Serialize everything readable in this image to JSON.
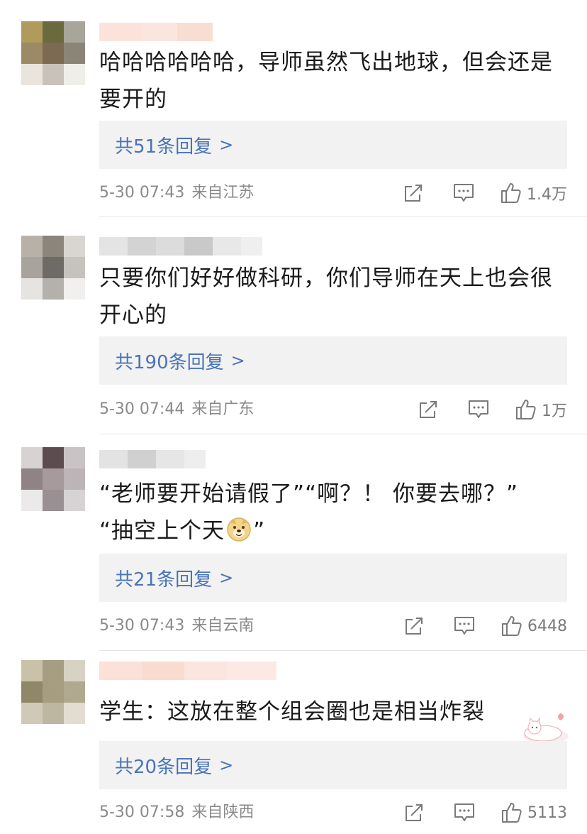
{
  "comments": [
    {
      "text": "哈哈哈哈哈哈，导师虽然飞出地球，但会还是要开的",
      "reply_count_label": "共51条回复",
      "reply_arrow": ">",
      "time": "5-30 07:43",
      "location": "来自江苏",
      "likes": "1.4万",
      "avatar_colors": [
        "#b09a5c",
        "#6b6a3e",
        "#a8a59a",
        "#9c8a66",
        "#7d6a52",
        "#8a8577",
        "#e9e4dc",
        "#c8c2ba",
        "#f0eee9"
      ]
    },
    {
      "text": "只要你们好好做科研，你们导师在天上也会很开心的",
      "reply_count_label": "共190条回复",
      "reply_arrow": ">",
      "time": "5-30 07:44",
      "location": "来自广东",
      "likes": "1万",
      "avatar_colors": [
        "#b8b1a8",
        "#8c857c",
        "#d9d6d2",
        "#a8a39d",
        "#6e6a66",
        "#c6c2bd",
        "#e6e4e1",
        "#b4b0ab",
        "#f1f0ee"
      ]
    },
    {
      "text_line1": "“老师要开始请假了”“啊？！ 你要去哪？”",
      "text_line2": "“抽空上个天",
      "text_line2_end": "”",
      "reply_count_label": "共21条回复",
      "reply_arrow": ">",
      "time": "5-30 07:43",
      "location": "来自云南",
      "likes": "6448",
      "avatar_colors": [
        "#d8d2d3",
        "#5c4c50",
        "#c9c3c5",
        "#8f8386",
        "#a69a9c",
        "#bcb4b6",
        "#ece9ea",
        "#9a8f92",
        "#d7d2d3"
      ]
    },
    {
      "text": "学生：这放在整个组会圈也是相当炸裂",
      "reply_count_label": "共20条回复",
      "reply_arrow": ">",
      "time": "5-30 07:58",
      "location": "来自陕西",
      "likes": "5113",
      "avatar_colors": [
        "#c9c1a8",
        "#a59e82",
        "#d7d2c4",
        "#8f8767",
        "#a69d80",
        "#b1a98f",
        "#cfc9b8",
        "#bdb6a0",
        "#e2ddd0"
      ]
    }
  ],
  "icons": {
    "share": "share-icon",
    "reply": "comment-icon",
    "like": "thumbs-up-icon",
    "emoji": "doge-emoji-icon",
    "sticker": "cat-sticker-icon"
  },
  "colors": {
    "reply_link": "#4a74b6",
    "meta_text": "#8a8a8a",
    "reply_box_bg": "#f2f2f2"
  }
}
